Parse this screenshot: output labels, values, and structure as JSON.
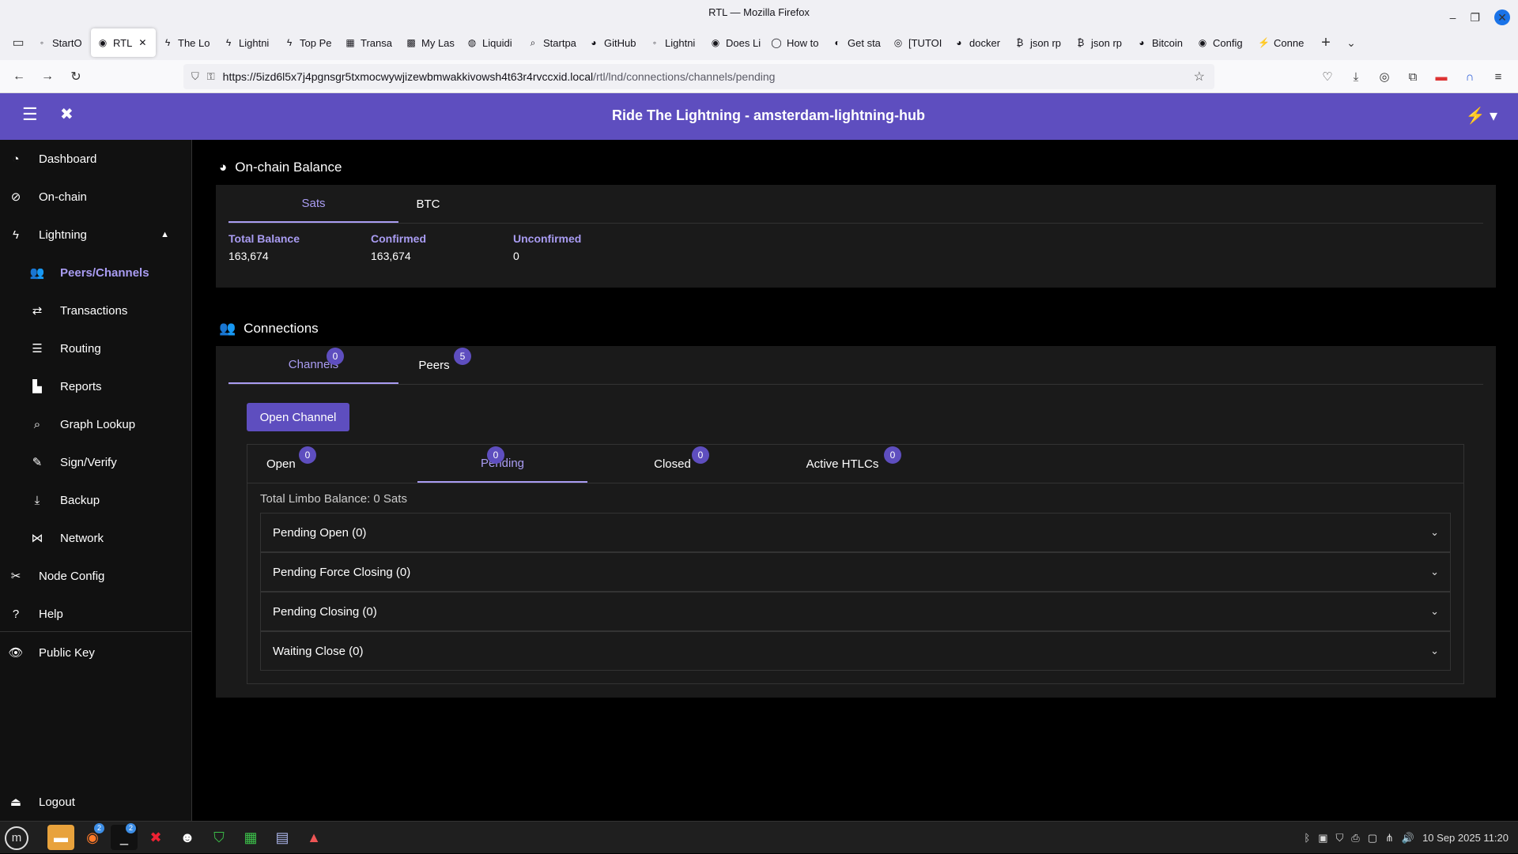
{
  "window": {
    "title": "RTL — Mozilla Firefox",
    "controls": [
      "–",
      "❐",
      "✕"
    ]
  },
  "tabs": [
    {
      "label": "StartO",
      "icon": "◦"
    },
    {
      "label": "RTL",
      "icon": "◉"
    },
    {
      "label": "The Lo",
      "icon": "ϟ"
    },
    {
      "label": "Lightni",
      "icon": "ϟ"
    },
    {
      "label": "Top Pe",
      "icon": "ϟ"
    },
    {
      "label": "Transa",
      "icon": "▦"
    },
    {
      "label": "My Las",
      "icon": "▩"
    },
    {
      "label": "Liquidi",
      "icon": "◍"
    },
    {
      "label": "Startpa",
      "icon": "⌕"
    },
    {
      "label": "GitHub",
      "icon": "◕"
    },
    {
      "label": "Lightni",
      "icon": "◦"
    },
    {
      "label": "Does Li",
      "icon": "◉"
    },
    {
      "label": "How to",
      "icon": "◯"
    },
    {
      "label": "Get sta",
      "icon": "◐"
    },
    {
      "label": "[TUTOI",
      "icon": "◎"
    },
    {
      "label": "docker",
      "icon": "◕"
    },
    {
      "label": "json rp",
      "icon": "₿"
    },
    {
      "label": "json rp",
      "icon": "₿"
    },
    {
      "label": "Bitcoin",
      "icon": "◕"
    },
    {
      "label": "Config",
      "icon": "◉"
    },
    {
      "label": "Conne",
      "icon": "⚡"
    }
  ],
  "urlbar": {
    "host": "https://5izd6l5x7j4pgnsgr5txmocwywjizewbmwakkivowsh4t63r4rvccxid.local",
    "path": "/rtl/lnd/connections/channels/pending"
  },
  "app": {
    "title": "Ride The Lightning - amsterdam-lightning-hub"
  },
  "sidebar": {
    "items": [
      {
        "label": "Dashboard",
        "icon": "◔"
      },
      {
        "label": "On-chain",
        "icon": "⊘"
      },
      {
        "label": "Lightning",
        "icon": "ϟ"
      },
      {
        "label": "Peers/Channels",
        "icon": "👥"
      },
      {
        "label": "Transactions",
        "icon": "⇄"
      },
      {
        "label": "Routing",
        "icon": "☰"
      },
      {
        "label": "Reports",
        "icon": "▙"
      },
      {
        "label": "Graph Lookup",
        "icon": "⌕"
      },
      {
        "label": "Sign/Verify",
        "icon": "✎"
      },
      {
        "label": "Backup",
        "icon": "⤓"
      },
      {
        "label": "Network",
        "icon": "⋈"
      },
      {
        "label": "Node Config",
        "icon": "✂"
      },
      {
        "label": "Help",
        "icon": "?"
      },
      {
        "label": "Public Key",
        "icon": "👁"
      },
      {
        "label": "Logout",
        "icon": "⏏"
      }
    ]
  },
  "onchain": {
    "title": "On-chain Balance",
    "tabs": [
      "Sats",
      "BTC"
    ],
    "total_label": "Total Balance",
    "total_value": "163,674",
    "confirmed_label": "Confirmed",
    "confirmed_value": "163,674",
    "unconfirmed_label": "Unconfirmed",
    "unconfirmed_value": "0"
  },
  "connections": {
    "title": "Connections",
    "tabs": [
      {
        "label": "Channels",
        "count": "0"
      },
      {
        "label": "Peers",
        "count": "5"
      }
    ],
    "open_channel_label": "Open Channel",
    "channel_tabs": [
      {
        "label": "Open",
        "count": "0"
      },
      {
        "label": "Pending",
        "count": "0"
      },
      {
        "label": "Closed",
        "count": "0"
      },
      {
        "label": "Active HTLCs",
        "count": "0"
      }
    ],
    "limbo_balance": "Total Limbo Balance: 0 Sats",
    "panels": [
      "Pending Open (0)",
      "Pending Force Closing (0)",
      "Pending Closing (0)",
      "Waiting Close (0)"
    ]
  },
  "taskbar": {
    "clock": "10 Sep 2025 11:20",
    "badges": [
      "2",
      "2"
    ]
  }
}
